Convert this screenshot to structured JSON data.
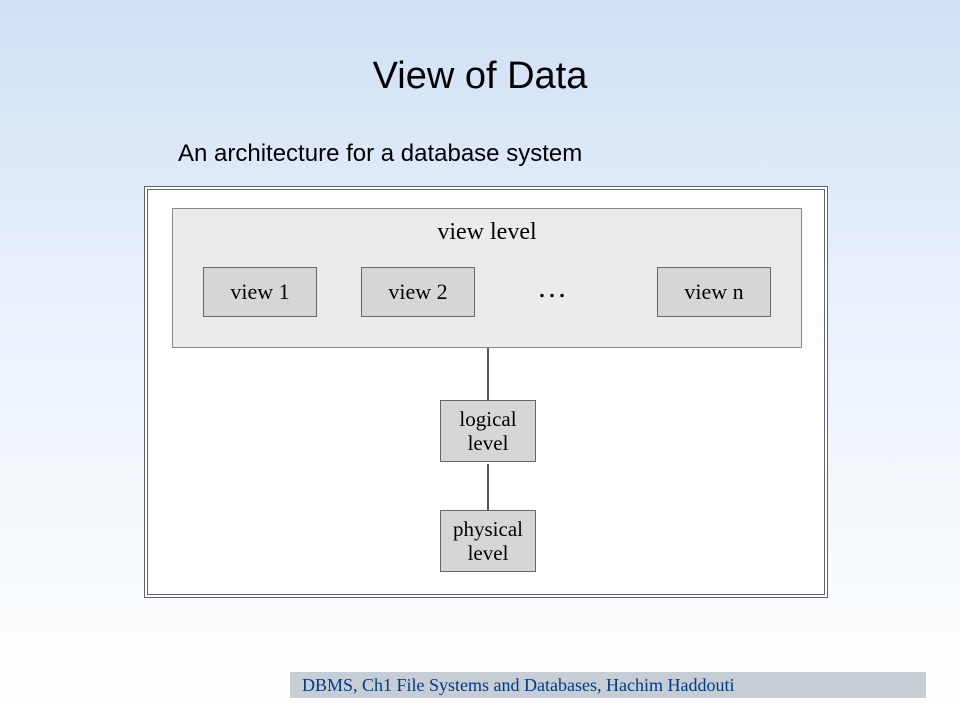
{
  "slide": {
    "title": "View of Data",
    "subtitle": "An architecture for a database system"
  },
  "diagram": {
    "view_level_label": "view level",
    "views": {
      "view1": "view 1",
      "view2": "view 2",
      "ellipsis": "…",
      "viewN": "view n"
    },
    "logical": {
      "line1": "logical",
      "line2": "level"
    },
    "physical": {
      "line1": "physical",
      "line2": "level"
    }
  },
  "footer": {
    "text": "DBMS, Ch1 File Systems and Databases, Hachim Haddouti"
  }
}
